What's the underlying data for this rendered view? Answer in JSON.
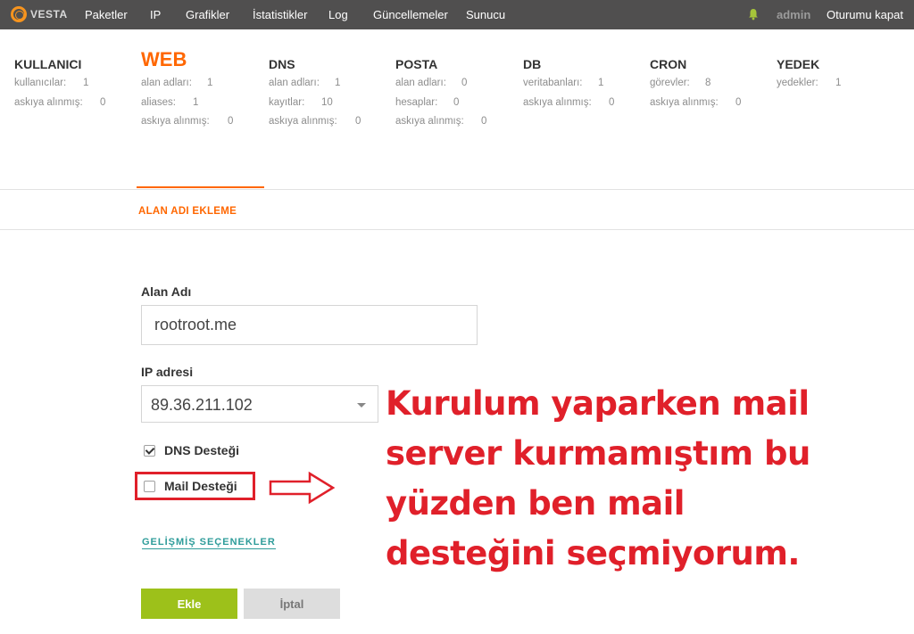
{
  "topbar": {
    "logo_text": "VESTA",
    "nav": [
      "Paketler",
      "IP",
      "Grafikler",
      "İstatistikler",
      "Log",
      "Güncellemeler",
      "Sunucu"
    ],
    "user": "admin",
    "logout": "Oturumu kapat"
  },
  "stats": {
    "kullanici": {
      "title": "KULLANICI",
      "rows": [
        {
          "label": "kullanıcılar:",
          "value": "1"
        },
        {
          "label": "askıya alınmış:",
          "value": "0"
        }
      ]
    },
    "web": {
      "title": "WEB",
      "rows": [
        {
          "label": "alan adları:",
          "value": "1"
        },
        {
          "label": "aliases:",
          "value": "1"
        },
        {
          "label": "askıya alınmış:",
          "value": "0"
        }
      ]
    },
    "dns": {
      "title": "DNS",
      "rows": [
        {
          "label": "alan adları:",
          "value": "1"
        },
        {
          "label": "kayıtlar:",
          "value": "10"
        },
        {
          "label": "askıya alınmış:",
          "value": "0"
        }
      ]
    },
    "posta": {
      "title": "POSTA",
      "rows": [
        {
          "label": "alan adları:",
          "value": "0"
        },
        {
          "label": "hesaplar:",
          "value": "0"
        },
        {
          "label": "askıya alınmış:",
          "value": "0"
        }
      ]
    },
    "db": {
      "title": "DB",
      "rows": [
        {
          "label": "veritabanları:",
          "value": "1"
        },
        {
          "label": "askıya alınmış:",
          "value": "0"
        }
      ]
    },
    "cron": {
      "title": "CRON",
      "rows": [
        {
          "label": "görevler:",
          "value": "8"
        },
        {
          "label": "askıya alınmış:",
          "value": "0"
        }
      ]
    },
    "yedek": {
      "title": "YEDEK",
      "rows": [
        {
          "label": "yedekler:",
          "value": "1"
        }
      ]
    }
  },
  "page": {
    "subtitle": "ALAN ADI EKLEME"
  },
  "form": {
    "domain_label": "Alan Adı",
    "domain_value": "rootroot.me",
    "ip_label": "IP adresi",
    "ip_value": "89.36.211.102",
    "dns_label": "DNS Desteği",
    "dns_checked": true,
    "mail_label": "Mail Desteği",
    "mail_checked": false,
    "advanced": "GELİŞMİŞ SEÇENEKLER",
    "add_button": "Ekle",
    "cancel_button": "İptal"
  },
  "annotation": {
    "lines": [
      "Kurulum yaparken mail",
      "server kurmamıştım bu",
      "yüzden ben mail",
      "desteğini seçmiyorum."
    ],
    "color": "#e0202a"
  },
  "colors": {
    "accent": "#ff6701",
    "topbar": "#504f4f",
    "add_button": "#9dc11a",
    "link": "#2e9c9a"
  }
}
